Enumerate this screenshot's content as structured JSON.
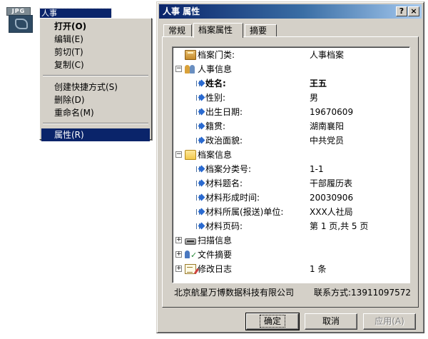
{
  "desktop_icon": {
    "tag": "JPG",
    "label": "人事"
  },
  "context_menu": {
    "items": [
      {
        "label": "打开(O)",
        "bold": true
      },
      {
        "label": "编辑(E)"
      },
      {
        "label": "剪切(T)"
      },
      {
        "label": "复制(C)"
      },
      {
        "label": "创建快捷方式(S)"
      },
      {
        "label": "删除(D)"
      },
      {
        "label": "重命名(M)"
      },
      {
        "label": "属性(R)",
        "selected": true
      }
    ]
  },
  "window": {
    "title": "人事 属性",
    "help_button": "?",
    "close_button": "×",
    "tabs": [
      {
        "label": "常规"
      },
      {
        "label": "档案属性",
        "active": true
      },
      {
        "label": "摘要"
      }
    ],
    "tree": {
      "archive_category_label": "档案门类:",
      "archive_category_value": "人事档案",
      "personnel": {
        "label": "人事信息",
        "toggle": "−",
        "fields": [
          {
            "label": "姓名:",
            "value": "王五"
          },
          {
            "label": "性别:",
            "value": "男"
          },
          {
            "label": "出生日期:",
            "value": "19670609"
          },
          {
            "label": "籍贯:",
            "value": "湖南襄阳"
          },
          {
            "label": "政治面貌:",
            "value": "中共党员"
          }
        ]
      },
      "archive_info": {
        "label": "档案信息",
        "toggle": "−",
        "fields": [
          {
            "label": "档案分类号:",
            "value": "1-1"
          },
          {
            "label": "材料题名:",
            "value": "干部履历表"
          },
          {
            "label": "材料形成时间:",
            "value": "20030906"
          },
          {
            "label": "材料所属(报送)单位:",
            "value": "XXX人社局"
          },
          {
            "label": "材料页码:",
            "value": "第 1 页,共 5 页"
          }
        ]
      },
      "scan_info": {
        "label": "扫描信息",
        "toggle": "+"
      },
      "file_summary": {
        "label": "文件摘要",
        "toggle": "+"
      },
      "modify_log": {
        "label": "修改日志",
        "toggle": "+",
        "value": "1 条"
      }
    },
    "company": "北京航星万博数据科技有限公司",
    "contact": "联系方式:13911097572",
    "buttons": {
      "ok": "确定",
      "cancel": "取消",
      "apply": "应用(A)"
    }
  }
}
